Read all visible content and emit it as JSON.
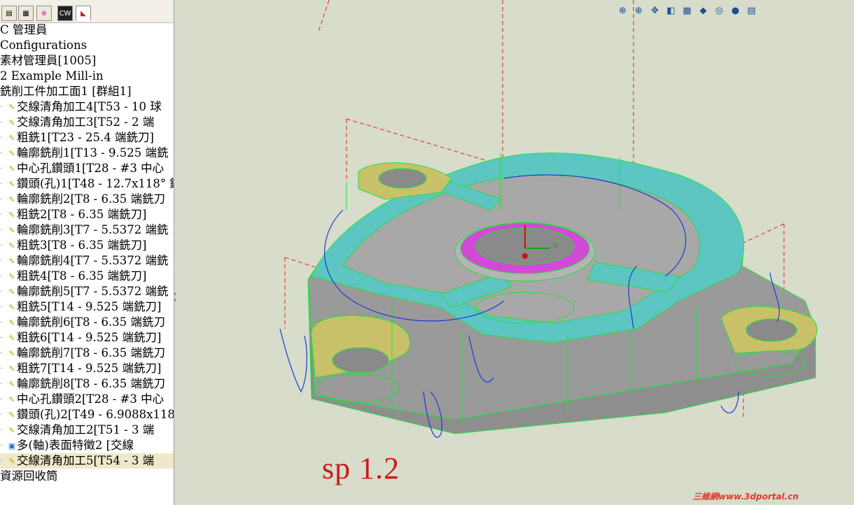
{
  "tabs": [
    {
      "name": "feature-manager-tab",
      "label": ""
    },
    {
      "name": "property-manager-tab",
      "label": ""
    },
    {
      "name": "configuration-tab",
      "label": ""
    },
    {
      "name": "camworks-tab",
      "label": "CW"
    },
    {
      "name": "operation-tree-tab",
      "label": ""
    }
  ],
  "tree": {
    "items": [
      {
        "text": "C 管理員",
        "icon": "",
        "selected": false
      },
      {
        "text": "Configurations",
        "icon": "",
        "selected": false
      },
      {
        "text": "素材管理員[1005]",
        "icon": "",
        "selected": false
      },
      {
        "text": "2 Example Mill-in",
        "icon": "",
        "selected": false
      },
      {
        "text": "銑削工件加工面1 [群組1]",
        "icon": "",
        "selected": false
      },
      {
        "text": "交線清角加工4[T53 - 10 球",
        "icon": "✎",
        "selected": false
      },
      {
        "text": "交線清角加工3[T52 - 2 端",
        "icon": "✎",
        "selected": false
      },
      {
        "text": "粗銑1[T23 - 25.4 端銑刀]",
        "icon": "✎",
        "selected": false
      },
      {
        "text": "輪廓銑削1[T13 - 9.525 端銑",
        "icon": "✎",
        "selected": false
      },
      {
        "text": "中心孔鑽頭1[T28 - #3 中心",
        "icon": "✎",
        "selected": false
      },
      {
        "text": "鑽頭(孔)1[T48 - 12.7x118° 鑽",
        "icon": "✎",
        "selected": false
      },
      {
        "text": "輪廓銑削2[T8 - 6.35 端銑刀",
        "icon": "✎",
        "selected": false
      },
      {
        "text": "粗銑2[T8 - 6.35 端銑刀]",
        "icon": "✎",
        "selected": false
      },
      {
        "text": "輪廓銑削3[T7 - 5.5372 端銑",
        "icon": "✎",
        "selected": false
      },
      {
        "text": "粗銑3[T8 - 6.35 端銑刀]",
        "icon": "✎",
        "selected": false
      },
      {
        "text": "輪廓銑削4[T7 - 5.5372 端銑",
        "icon": "✎",
        "selected": false
      },
      {
        "text": "粗銑4[T8 - 6.35 端銑刀]",
        "icon": "✎",
        "selected": false
      },
      {
        "text": "輪廓銑削5[T7 - 5.5372 端銑",
        "icon": "✎",
        "selected": false
      },
      {
        "text": "粗銑5[T14 - 9.525 端銑刀]",
        "icon": "✎",
        "selected": false
      },
      {
        "text": "輪廓銑削6[T8 - 6.35 端銑刀",
        "icon": "✎",
        "selected": false
      },
      {
        "text": "粗銑6[T14 - 9.525 端銑刀]",
        "icon": "✎",
        "selected": false
      },
      {
        "text": "輪廓銑削7[T8 - 6.35 端銑刀",
        "icon": "✎",
        "selected": false
      },
      {
        "text": "粗銑7[T14 - 9.525 端銑刀]",
        "icon": "✎",
        "selected": false
      },
      {
        "text": "輪廓銑削8[T8 - 6.35 端銑刀",
        "icon": "✎",
        "selected": false
      },
      {
        "text": "中心孔鑽頭2[T28 - #3 中心",
        "icon": "✎",
        "selected": false
      },
      {
        "text": "鑽頭(孔)2[T49 - 6.9088x118",
        "icon": "✎",
        "selected": false
      },
      {
        "text": "交線清角加工2[T51 - 3 端",
        "icon": "✎",
        "selected": false
      },
      {
        "text": "多(軸)表面特徵2 [交線",
        "icon": "▣",
        "selected": false
      },
      {
        "text": "交線清角加工5[T54 - 3 端",
        "icon": "✎",
        "selected": true
      },
      {
        "text": "資源回收筒",
        "icon": "",
        "selected": false
      }
    ]
  },
  "splitter": {
    "glyph": "‹ ‹"
  },
  "toolbar": {
    "buttons": [
      {
        "name": "zoom-to-fit-icon",
        "glyph": "⊕"
      },
      {
        "name": "zoom-area-icon",
        "glyph": "⊕"
      },
      {
        "name": "pan-icon",
        "glyph": "✥"
      },
      {
        "name": "section-view-icon",
        "glyph": "◧"
      },
      {
        "name": "view-orientation-icon",
        "glyph": "▦"
      },
      {
        "name": "display-style-icon",
        "glyph": "◆"
      },
      {
        "name": "hide-show-icon",
        "glyph": "◎"
      },
      {
        "name": "appearance-icon",
        "glyph": "●"
      },
      {
        "name": "scene-icon",
        "glyph": "▤"
      }
    ]
  },
  "triad": {
    "y_label": "Y"
  },
  "overlay_text": "sp 1.2",
  "watermark": "三維網www.3dportal.cn",
  "colors": {
    "background": "#d7dccb",
    "top_face": "#5ec6c2",
    "side_face": "#8e8e8e",
    "boss_face": "#c9c16a",
    "toolpath": "#1a3ad6",
    "edges": "#1ee23a",
    "rapid": "#e02020",
    "hole_ring": "#d24ad6"
  }
}
